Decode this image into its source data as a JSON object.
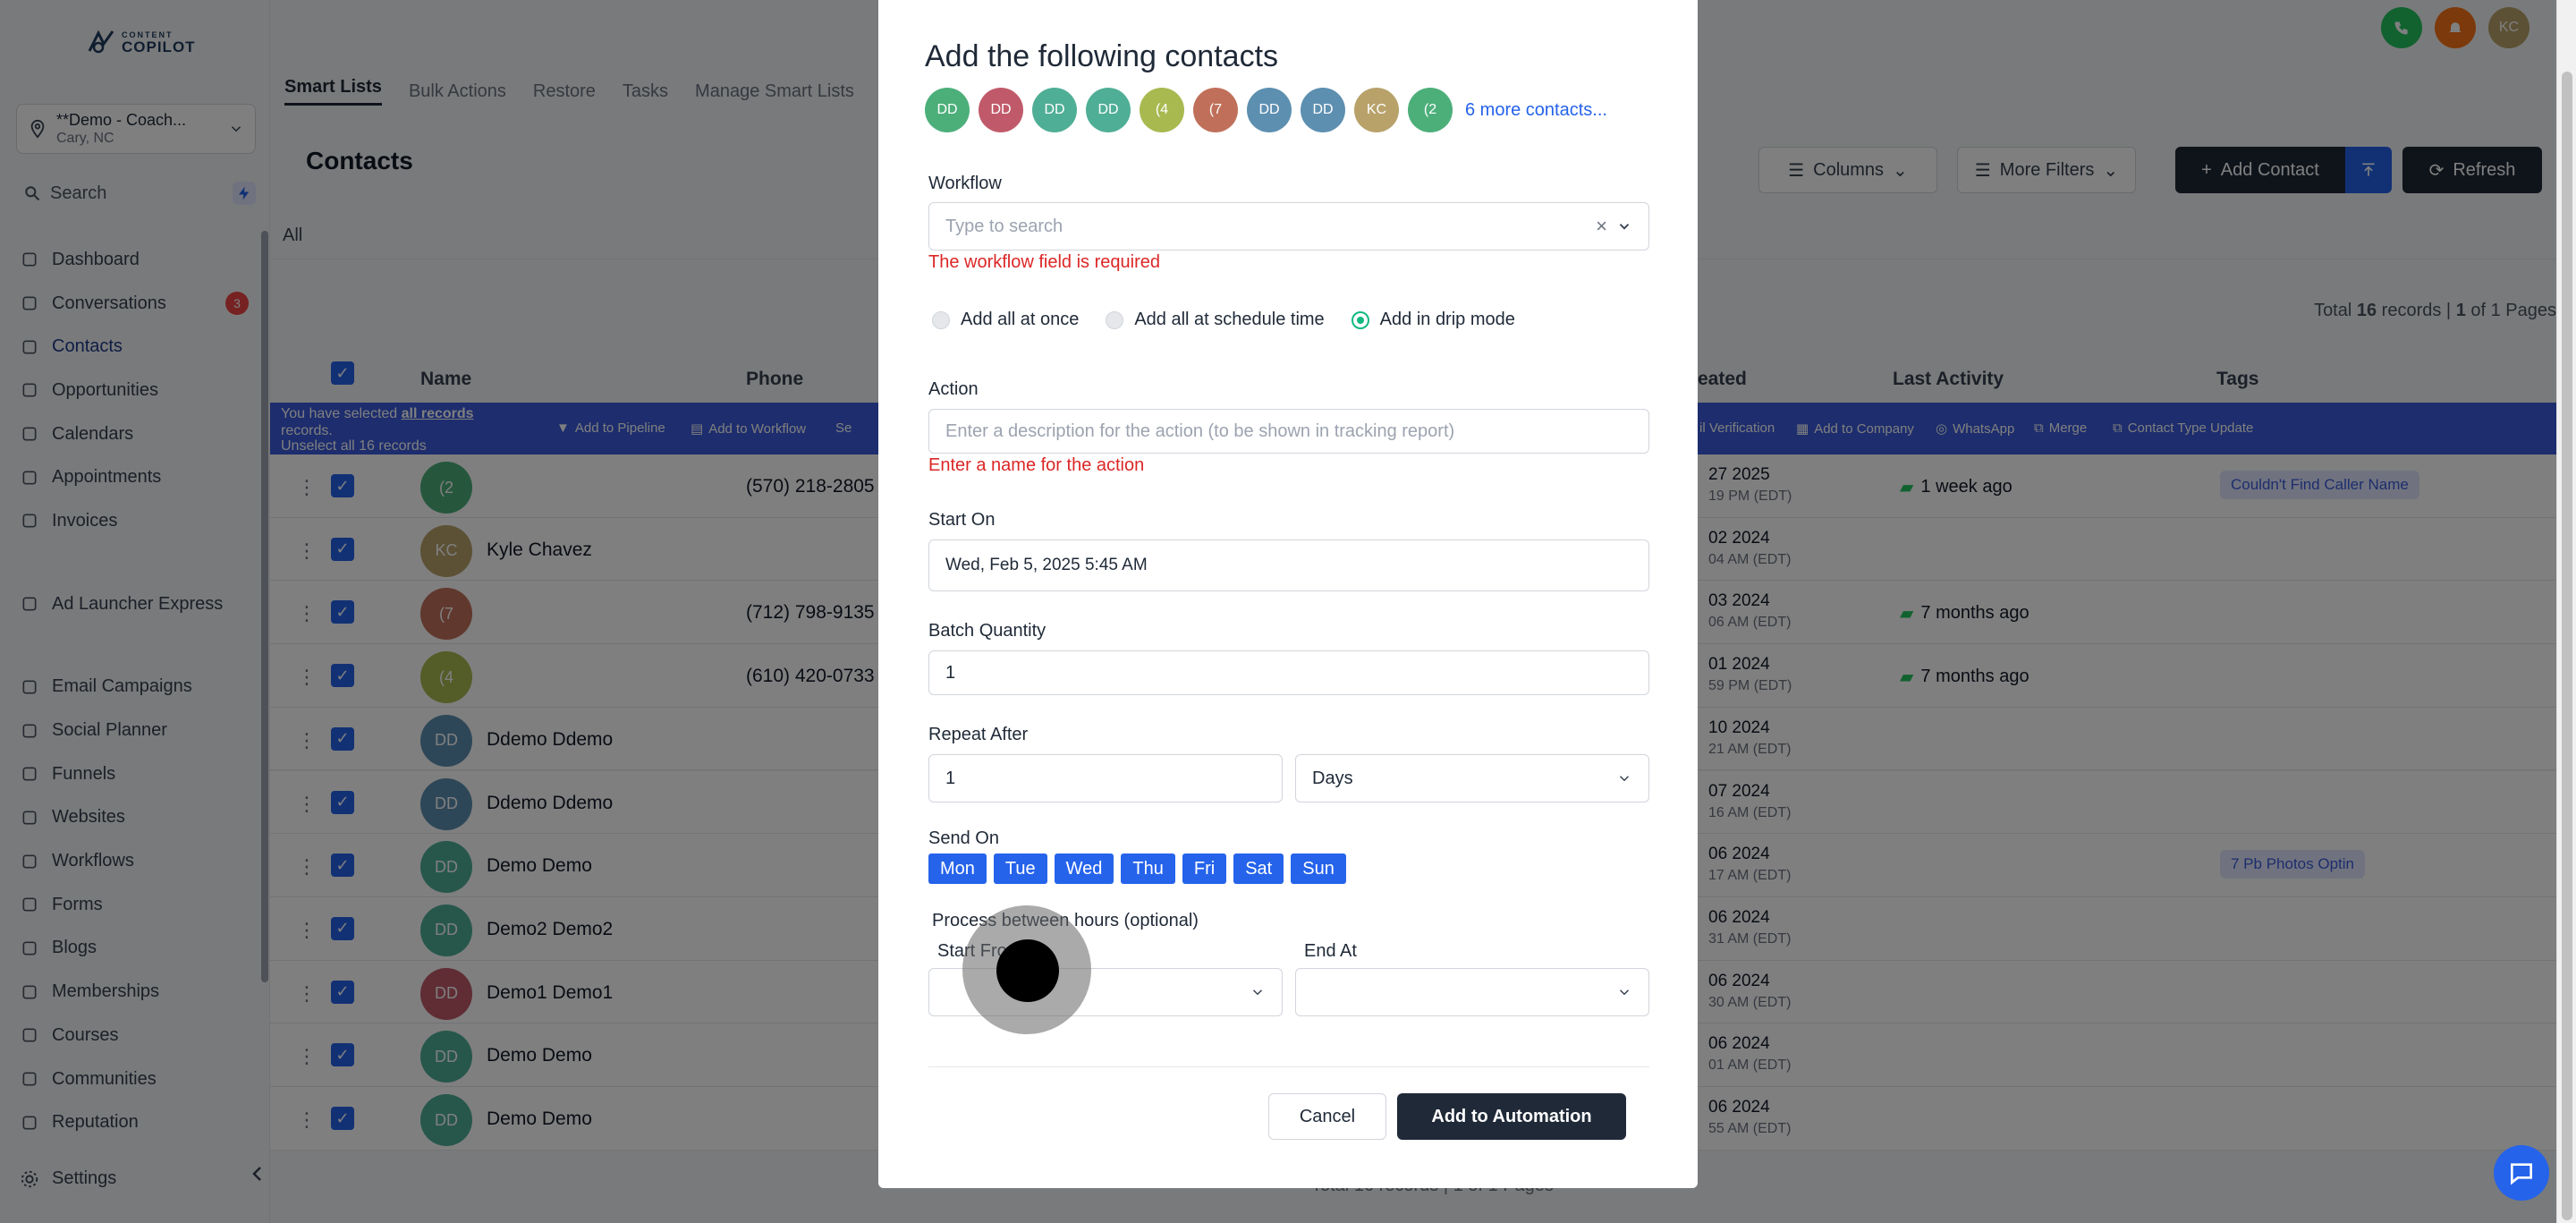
{
  "app": {
    "logo_small": "CONTENT",
    "logo_big": "COPILOT"
  },
  "sidebar": {
    "location_name": "**Demo - Coach...",
    "location_city": "Cary, NC",
    "search": "Search",
    "items": [
      {
        "label": "Dashboard",
        "icon": "dashboard-icon"
      },
      {
        "label": "Conversations",
        "icon": "chat-icon",
        "badge": "3"
      },
      {
        "label": "Contacts",
        "icon": "user-icon",
        "active": true
      },
      {
        "label": "Opportunities",
        "icon": "funnel-icon"
      },
      {
        "label": "Calendars",
        "icon": "calendar-icon"
      },
      {
        "label": "Appointments",
        "icon": "list-icon"
      },
      {
        "label": "Invoices",
        "icon": "invoice-icon"
      }
    ],
    "items2": [
      {
        "label": "Ad Launcher Express",
        "icon": "rocket-icon"
      }
    ],
    "items3": [
      {
        "label": "Email Campaigns",
        "icon": "send-icon"
      },
      {
        "label": "Social Planner",
        "icon": "grid-icon"
      },
      {
        "label": "Funnels",
        "icon": "funnel-icon"
      },
      {
        "label": "Websites",
        "icon": "monitor-icon"
      },
      {
        "label": "Workflows",
        "icon": "workflow-icon"
      },
      {
        "label": "Forms",
        "icon": "form-icon"
      },
      {
        "label": "Blogs",
        "icon": "blog-icon"
      },
      {
        "label": "Memberships",
        "icon": "membership-icon"
      },
      {
        "label": "Courses",
        "icon": "book-icon"
      },
      {
        "label": "Communities",
        "icon": "community-icon"
      },
      {
        "label": "Reputation",
        "icon": "star-icon"
      }
    ],
    "settings": "Settings"
  },
  "topbar": {
    "tabs": [
      "Smart Lists",
      "Bulk Actions",
      "Restore",
      "Tasks",
      "Manage Smart Lists"
    ],
    "avatar_initials": "KC"
  },
  "contacts": {
    "title": "Contacts",
    "columns_btn": "Columns",
    "filters_btn": "More Filters",
    "add_btn": "Add Contact",
    "refresh_btn": "Refresh",
    "segment_all": "All",
    "total_prefix": "Total ",
    "total_count": "16",
    "total_mid": " records | ",
    "page_cur": "1",
    "page_suffix": " of 1 Pages",
    "headers": {
      "name": "Name",
      "phone": "Phone",
      "created": "eated",
      "last_activity": "Last Activity",
      "tags": "Tags"
    },
    "selbar": {
      "line1a": "You have selected ",
      "line1b": "all records",
      "line2": "records.",
      "line3": "Unselect all 16 records",
      "actions": [
        "Add to Pipeline",
        "Add to Workflow",
        "Se",
        "il Verification",
        "Add to Company",
        "WhatsApp",
        "Merge",
        "Contact Type Update"
      ]
    },
    "rows": [
      {
        "initials": "(2",
        "color": "#4caf7a",
        "name": "",
        "phone": "(570) 218-2805",
        "c1": "27 2025",
        "c2": "19 PM (EDT)",
        "activity": "1 week ago",
        "tag": "Couldn't Find Caller Name"
      },
      {
        "initials": "KC",
        "color": "#b8a26a",
        "name": "Kyle Chavez",
        "phone": "",
        "c1": "02 2024",
        "c2": "04 AM (EDT)",
        "activity": "",
        "tag": ""
      },
      {
        "initials": "(7",
        "color": "#c0705a",
        "name": "",
        "phone": "(712) 798-9135",
        "c1": "03 2024",
        "c2": "06 AM (EDT)",
        "activity": "7 months ago",
        "tag": ""
      },
      {
        "initials": "(4",
        "color": "#a8b950",
        "name": "",
        "phone": "(610) 420-0733",
        "c1": "01 2024",
        "c2": "59 PM (EDT)",
        "activity": "7 months ago",
        "tag": ""
      },
      {
        "initials": "DD",
        "color": "#5d8fb0",
        "name": "Ddemo Ddemo",
        "phone": "",
        "c1": "10 2024",
        "c2": "21 AM (EDT)",
        "activity": "",
        "tag": ""
      },
      {
        "initials": "DD",
        "color": "#5d8fb0",
        "name": "Ddemo Ddemo",
        "phone": "",
        "c1": "07 2024",
        "c2": "16 AM (EDT)",
        "activity": "",
        "tag": ""
      },
      {
        "initials": "DD",
        "color": "#4fae96",
        "name": "Demo Demo",
        "phone": "",
        "c1": "06 2024",
        "c2": "17 AM (EDT)",
        "activity": "",
        "tag": "7 Pb Photos Optin"
      },
      {
        "initials": "DD",
        "color": "#4fae96",
        "name": "Demo2 Demo2",
        "phone": "",
        "c1": "06 2024",
        "c2": "31 AM (EDT)",
        "activity": "",
        "tag": ""
      },
      {
        "initials": "DD",
        "color": "#c05a6a",
        "name": "Demo1 Demo1",
        "phone": "",
        "c1": "06 2024",
        "c2": "30 AM (EDT)",
        "activity": "",
        "tag": ""
      },
      {
        "initials": "DD",
        "color": "#4fae96",
        "name": "Demo Demo",
        "phone": "",
        "c1": "06 2024",
        "c2": "01 AM (EDT)",
        "activity": "",
        "tag": ""
      },
      {
        "initials": "DD",
        "color": "#4fae96",
        "name": "Demo Demo",
        "phone": "",
        "c1": "06 2024",
        "c2": "55 AM (EDT)",
        "activity": "",
        "tag": ""
      }
    ],
    "footer": "Total 16 records | 1 of 1 Pages"
  },
  "modal": {
    "title": "Add the following contacts",
    "chips": [
      {
        "t": "DD",
        "c": "#4caf7a"
      },
      {
        "t": "DD",
        "c": "#c05a6a"
      },
      {
        "t": "DD",
        "c": "#4fae96"
      },
      {
        "t": "DD",
        "c": "#4fae96"
      },
      {
        "t": "(4",
        "c": "#a8b950"
      },
      {
        "t": "(7",
        "c": "#c0705a"
      },
      {
        "t": "DD",
        "c": "#5d8fb0"
      },
      {
        "t": "DD",
        "c": "#5d8fb0"
      },
      {
        "t": "KC",
        "c": "#b8a26a"
      },
      {
        "t": "(2",
        "c": "#4caf7a"
      }
    ],
    "more_contacts": "6 more contacts...",
    "workflow_label": "Workflow",
    "workflow_placeholder": "Type to search",
    "workflow_error": "The workflow field is required",
    "radio_options": [
      "Add all at once",
      "Add all at schedule time",
      "Add in drip mode"
    ],
    "action_label": "Action",
    "action_placeholder": "Enter a description for the action (to be shown in tracking report)",
    "action_error": "Enter a name for the action",
    "start_on_label": "Start On",
    "start_on_value": "Wed, Feb 5, 2025 5:45 AM",
    "batch_label": "Batch Quantity",
    "batch_value": "1",
    "repeat_label": "Repeat After",
    "repeat_value": "1",
    "repeat_unit": "Days",
    "send_on_label": "Send On",
    "days": [
      "Mon",
      "Tue",
      "Wed",
      "Thu",
      "Fri",
      "Sat",
      "Sun"
    ],
    "process_label": "Process between hours (optional)",
    "start_from_label": "Start From",
    "end_at_label": "End At",
    "cancel": "Cancel",
    "submit": "Add to Automation"
  }
}
